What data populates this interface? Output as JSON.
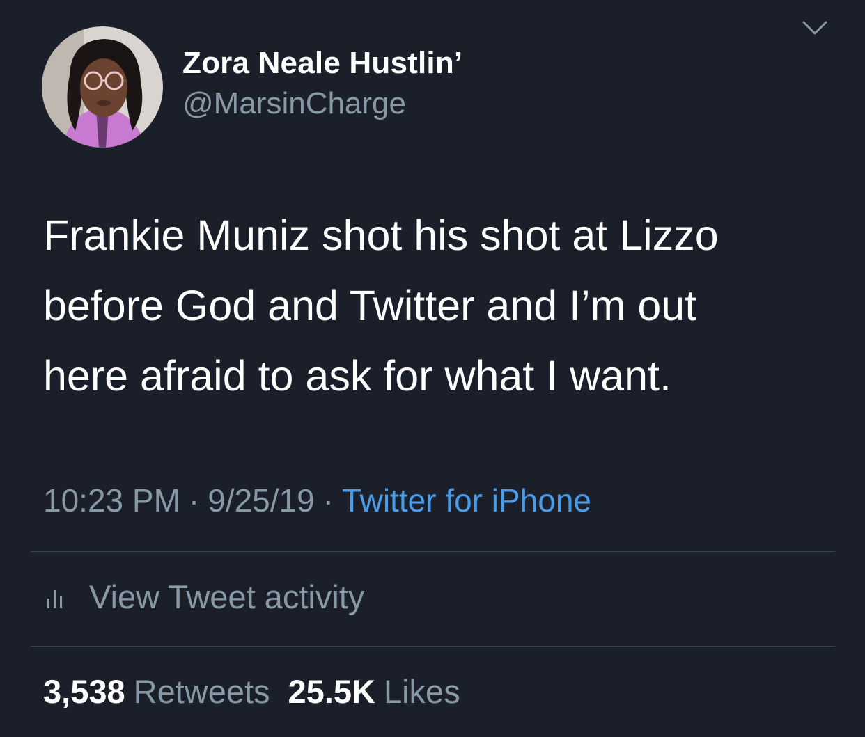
{
  "author": {
    "display_name": "Zora Neale Hustlin’",
    "handle": "@MarsinCharge",
    "avatar_icon": "profile-photo"
  },
  "tweet": {
    "lines": [
      "Frankie Muniz shot his shot at Lizzo",
      "before God and Twitter and I’m out",
      "here afraid to ask for what I want."
    ],
    "time": "10:23 PM",
    "date": "9/25/19",
    "separator": "·",
    "source": "Twitter for iPhone"
  },
  "activity": {
    "label": "View Tweet activity",
    "icon": "bar-chart-icon"
  },
  "stats": {
    "retweets_count": "3,538",
    "retweets_label": "Retweets",
    "likes_count": "25.5K",
    "likes_label": "Likes"
  },
  "colors": {
    "background": "#1a1f29",
    "text": "#ffffff",
    "secondary": "#8899a6",
    "link": "#4a9be8",
    "divider": "#38444d"
  }
}
